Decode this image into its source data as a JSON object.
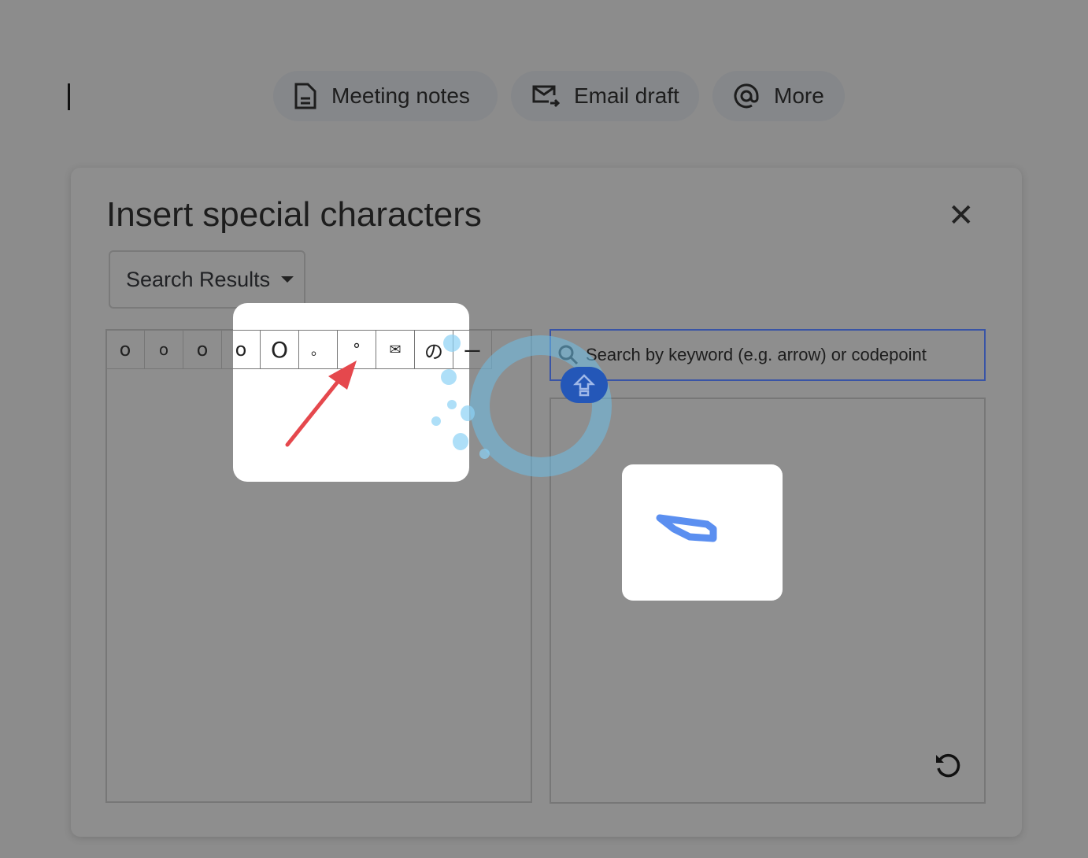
{
  "toolbar": {
    "chips": [
      {
        "label": "Meeting notes",
        "icon": "document-icon"
      },
      {
        "label": "Email draft",
        "icon": "email-send-icon"
      },
      {
        "label": "More",
        "icon": "at-sign-icon"
      }
    ]
  },
  "dialog": {
    "title": "Insert special characters",
    "category": "Search Results",
    "characters": [
      "o",
      "o",
      "o",
      "o",
      "O",
      "。",
      "°",
      "✉",
      "の",
      "ー"
    ],
    "search_placeholder": "Search by keyword (e.g. arrow) or codepoint"
  },
  "colors": {
    "annotation_arrow": "#e5484d",
    "focus_border": "#3954a6",
    "drawn_stroke": "#5b8ff0"
  }
}
